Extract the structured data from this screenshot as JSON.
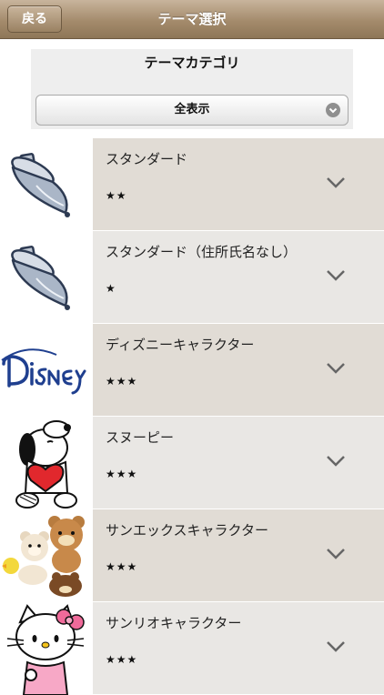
{
  "navbar": {
    "back_label": "戻る",
    "title": "テーマ選択"
  },
  "filter": {
    "title": "テーマカテゴリ",
    "selected": "全表示"
  },
  "themes": [
    {
      "name": "スタンダード",
      "rating": "★★",
      "thumbnail": "spinning-top-icon"
    },
    {
      "name": "スタンダード（住所氏名なし）",
      "rating": "★",
      "thumbnail": "spinning-top-icon"
    },
    {
      "name": "ディズニーキャラクター",
      "rating": "★★★",
      "thumbnail": "disney-logo"
    },
    {
      "name": "スヌーピー",
      "rating": "★★★",
      "thumbnail": "snoopy-character"
    },
    {
      "name": "サンエックスキャラクター",
      "rating": "★★★",
      "thumbnail": "rilakkuma-characters"
    },
    {
      "name": "サンリオキャラクター",
      "rating": "★★★",
      "thumbnail": "hello-kitty-character"
    }
  ],
  "colors": {
    "navbar": "#a48b6c",
    "row_bg": "#e9e7e4",
    "row_bg_alt": "#e1dcd5"
  }
}
